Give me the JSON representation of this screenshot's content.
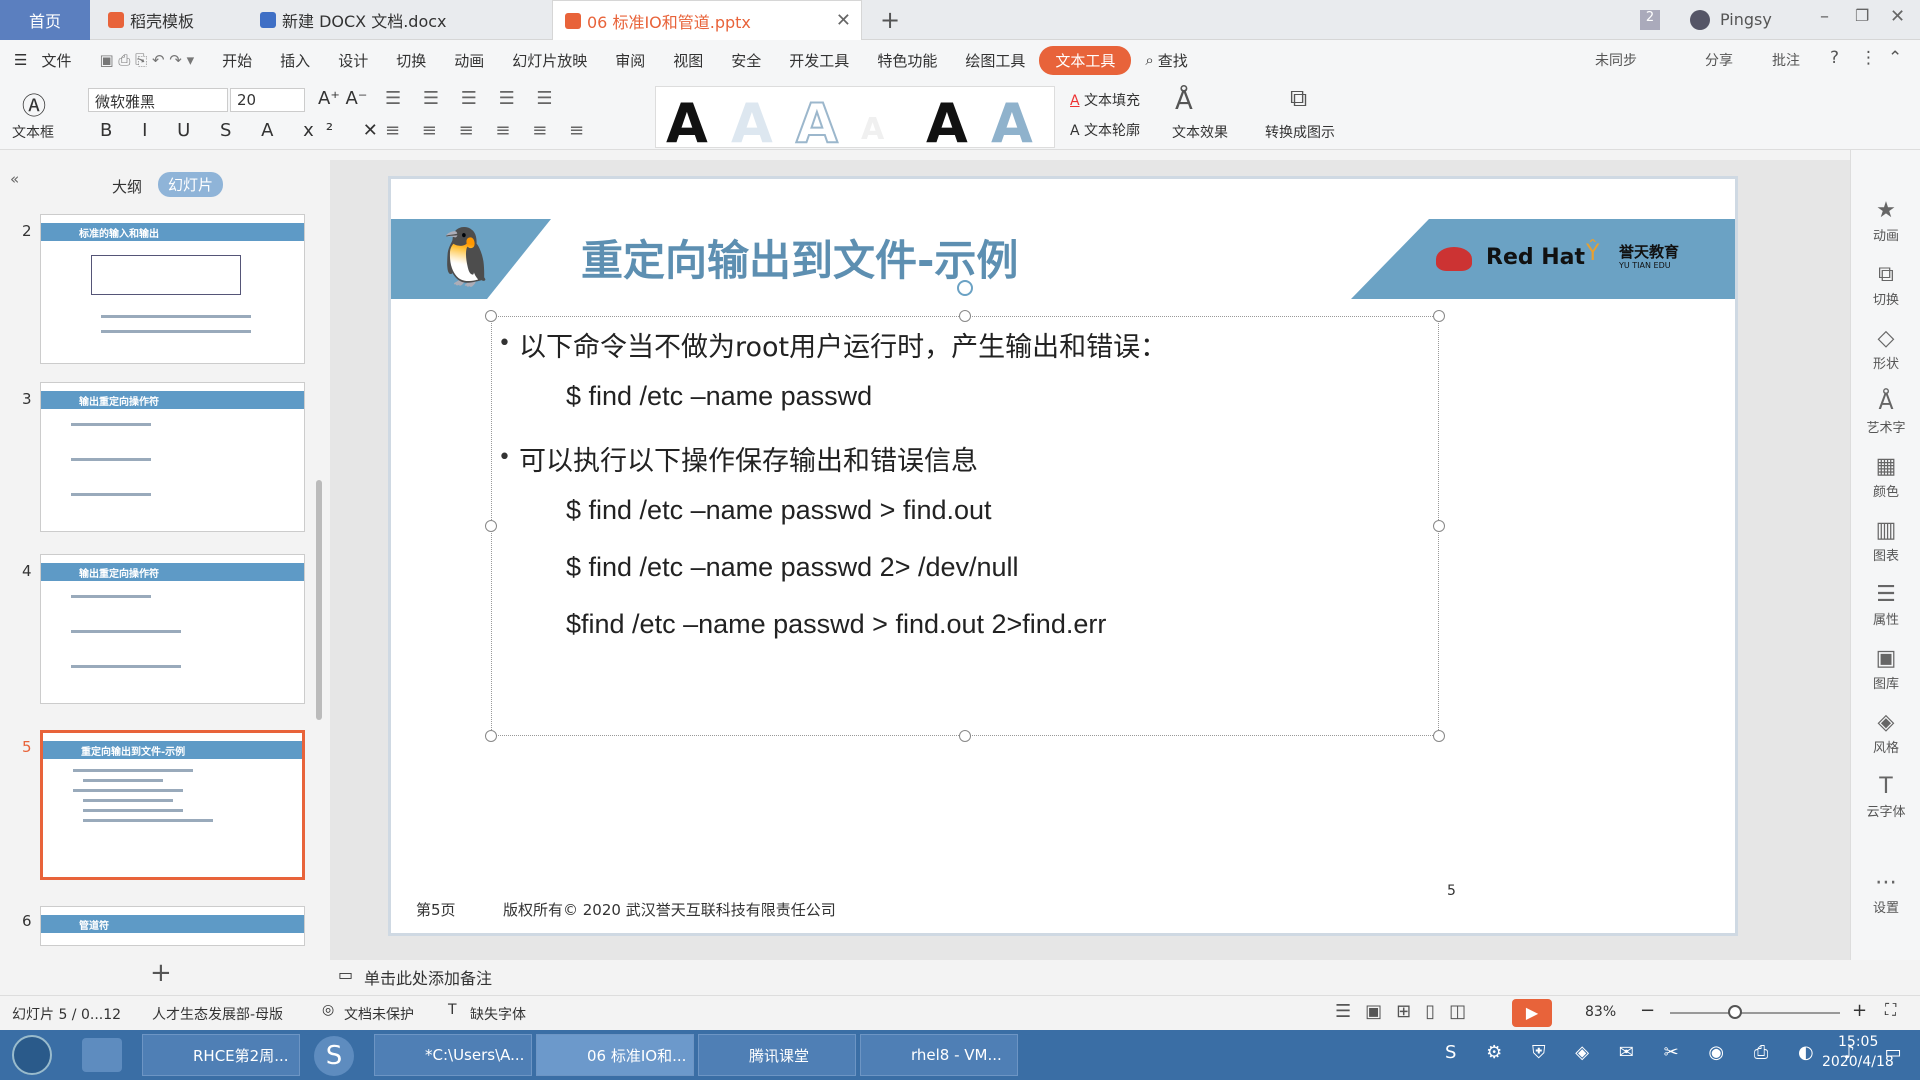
{
  "titlebar": {
    "tabs": [
      {
        "label": "首页"
      },
      {
        "label": "稻壳模板"
      },
      {
        "label": "新建 DOCX 文档.docx"
      },
      {
        "label": "06 标准IO和管道.pptx"
      }
    ],
    "badge": "2",
    "user": "Pingsy",
    "new_tab": "+"
  },
  "menubar": {
    "file": "文件",
    "items": [
      "开始",
      "插入",
      "设计",
      "切换",
      "动画",
      "幻灯片放映",
      "审阅",
      "视图",
      "安全",
      "开发工具",
      "特色功能",
      "绘图工具",
      "文本工具"
    ],
    "search": "查找",
    "sync": "未同步",
    "share": "分享",
    "comment": "批注"
  },
  "ribbon": {
    "textbox": "文本框",
    "font": "微软雅黑",
    "size": "20",
    "text_fill": "文本填充",
    "text_outline": "文本轮廓",
    "text_effect": "文本效果",
    "convert": "转换成图示"
  },
  "leftpanel": {
    "tab_outline": "大纲",
    "tab_slides": "幻灯片",
    "thumbs": [
      {
        "num": "2",
        "title": "标准的输入和输出"
      },
      {
        "num": "3",
        "title": "输出重定向操作符"
      },
      {
        "num": "4",
        "title": "输出重定向操作符"
      },
      {
        "num": "5",
        "title": "重定向输出到文件-示例"
      },
      {
        "num": "6",
        "title": "管道符"
      }
    ],
    "add": "+"
  },
  "slide": {
    "title": "重定向输出到文件-示例",
    "brand": "Red Hat",
    "brand2": "誉天教育",
    "brand3": "YU TIAN EDU",
    "bullet1": "以下命令当不做为root用户运行时，产生输出和错误：",
    "code1": "$ find /etc –name passwd",
    "bullet2": "可以执行以下操作保存输出和错误信息",
    "code2": "$ find /etc –name passwd > find.out",
    "code3": "$ find /etc –name passwd 2> /dev/null",
    "code4": "$find /etc –name passwd > find.out 2>find.err",
    "footer_page": "第5页",
    "footer_copy": "版权所有© 2020 武汉誉天互联科技有限责任公司",
    "page_num": "5"
  },
  "notes": {
    "placeholder": "单击此处添加备注"
  },
  "statusbar": {
    "slide": "幻灯片 5 / 0...12",
    "template": "人才生态发展部-母版",
    "protect": "文档未保护",
    "font_missing": "缺失字体",
    "zoom": "83%"
  },
  "rightbar": {
    "items": [
      "动画",
      "切换",
      "形状",
      "艺术字",
      "颜色",
      "图表",
      "属性",
      "图库",
      "风格",
      "云字体",
      "设置"
    ]
  },
  "taskbar": {
    "items": [
      "RHCE第2周...",
      "*C:\\Users\\A...",
      "06 标准IO和...",
      "腾讯课堂",
      "rhel8 - VM..."
    ],
    "time": "15:05",
    "date": "2020/4/18"
  }
}
